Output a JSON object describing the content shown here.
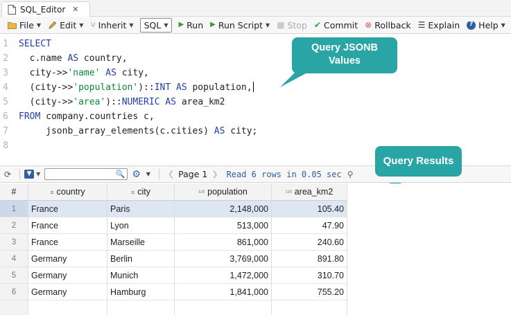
{
  "tab": {
    "title": "SQL_Editor",
    "icon": "sql-file-icon",
    "close": "✕"
  },
  "toolbar": {
    "items": [
      {
        "label": "File",
        "icon": "folder-icon",
        "has_menu": true
      },
      {
        "label": "Edit",
        "icon": "pencil-icon",
        "has_menu": true
      },
      {
        "label": "Inherit",
        "icon": "inherit-icon",
        "has_menu": true
      },
      {
        "label": "SQL",
        "icon": "",
        "has_menu": true,
        "boxed": true
      },
      {
        "label": "Run",
        "icon": "play-icon",
        "has_menu": false
      },
      {
        "label": "Run Script",
        "icon": "play-icon",
        "has_menu": true
      },
      {
        "label": "Stop",
        "icon": "stop-icon",
        "has_menu": false,
        "disabled": true
      },
      {
        "label": "Commit",
        "icon": "check-circle-icon",
        "has_menu": false
      },
      {
        "label": "Rollback",
        "icon": "x-circle-icon",
        "has_menu": false
      },
      {
        "label": "Explain",
        "icon": "explain-icon",
        "has_menu": false
      },
      {
        "label": "Help",
        "icon": "help-icon",
        "has_menu": true
      }
    ]
  },
  "editor": {
    "lines": [
      {
        "n": "1",
        "tokens": [
          {
            "t": "SELECT",
            "c": "kw"
          }
        ]
      },
      {
        "n": "2",
        "tokens": [
          {
            "t": "  c.name ",
            "c": ""
          },
          {
            "t": "AS",
            "c": "kw"
          },
          {
            "t": " country,",
            "c": ""
          }
        ]
      },
      {
        "n": "3",
        "tokens": [
          {
            "t": "  city->>",
            "c": ""
          },
          {
            "t": "'name'",
            "c": "str"
          },
          {
            "t": " ",
            "c": ""
          },
          {
            "t": "AS",
            "c": "kw"
          },
          {
            "t": " city,",
            "c": ""
          }
        ]
      },
      {
        "n": "4",
        "tokens": [
          {
            "t": "  (city->>",
            "c": ""
          },
          {
            "t": "'population'",
            "c": "str"
          },
          {
            "t": ")::",
            "c": ""
          },
          {
            "t": "INT",
            "c": "kw"
          },
          {
            "t": " ",
            "c": ""
          },
          {
            "t": "AS",
            "c": "kw"
          },
          {
            "t": " population,",
            "c": ""
          }
        ],
        "caret": true
      },
      {
        "n": "5",
        "tokens": [
          {
            "t": "  (city->>",
            "c": ""
          },
          {
            "t": "'area'",
            "c": "str"
          },
          {
            "t": ")::",
            "c": ""
          },
          {
            "t": "NUMERIC",
            "c": "kw"
          },
          {
            "t": " ",
            "c": ""
          },
          {
            "t": "AS",
            "c": "kw"
          },
          {
            "t": " area_km2",
            "c": ""
          }
        ]
      },
      {
        "n": "6",
        "tokens": [
          {
            "t": "FROM",
            "c": "kw"
          },
          {
            "t": " company.countries c,",
            "c": ""
          }
        ]
      },
      {
        "n": "7",
        "tokens": [
          {
            "t": "     jsonb_array_elements(c.cities) ",
            "c": ""
          },
          {
            "t": "AS",
            "c": "kw"
          },
          {
            "t": " city;",
            "c": ""
          }
        ]
      },
      {
        "n": "8",
        "tokens": [
          {
            "t": "",
            "c": ""
          }
        ]
      }
    ]
  },
  "callouts": {
    "jsonb": "Query JSONB Values",
    "results": "Query Results"
  },
  "results_bar": {
    "page_label": "Page 1",
    "status": "Read 6 rows in 0.05 sec"
  },
  "grid": {
    "columns": [
      {
        "label": "#",
        "icon": ""
      },
      {
        "label": "country",
        "icon": "≡"
      },
      {
        "label": "city",
        "icon": "≡"
      },
      {
        "label": "population",
        "icon": "¹²³"
      },
      {
        "label": "area_km2",
        "icon": "¹²³"
      }
    ],
    "rows": [
      {
        "n": "1",
        "country": "France",
        "city": "Paris",
        "population": "2,148,000",
        "area": "105.40"
      },
      {
        "n": "2",
        "country": "France",
        "city": "Lyon",
        "population": "513,000",
        "area": "47.90"
      },
      {
        "n": "3",
        "country": "France",
        "city": "Marseille",
        "population": "861,000",
        "area": "240.60"
      },
      {
        "n": "4",
        "country": "Germany",
        "city": "Berlin",
        "population": "3,769,000",
        "area": "891.80"
      },
      {
        "n": "5",
        "country": "Germany",
        "city": "Munich",
        "population": "1,472,000",
        "area": "310.70"
      },
      {
        "n": "6",
        "country": "Germany",
        "city": "Hamburg",
        "population": "1,841,000",
        "area": "755.20"
      }
    ],
    "selected_row": 1
  },
  "colors": {
    "callout": "#2aa5a5",
    "keyword": "#1f3fa6",
    "string": "#0a8a39",
    "selection": "#dde6f3"
  }
}
